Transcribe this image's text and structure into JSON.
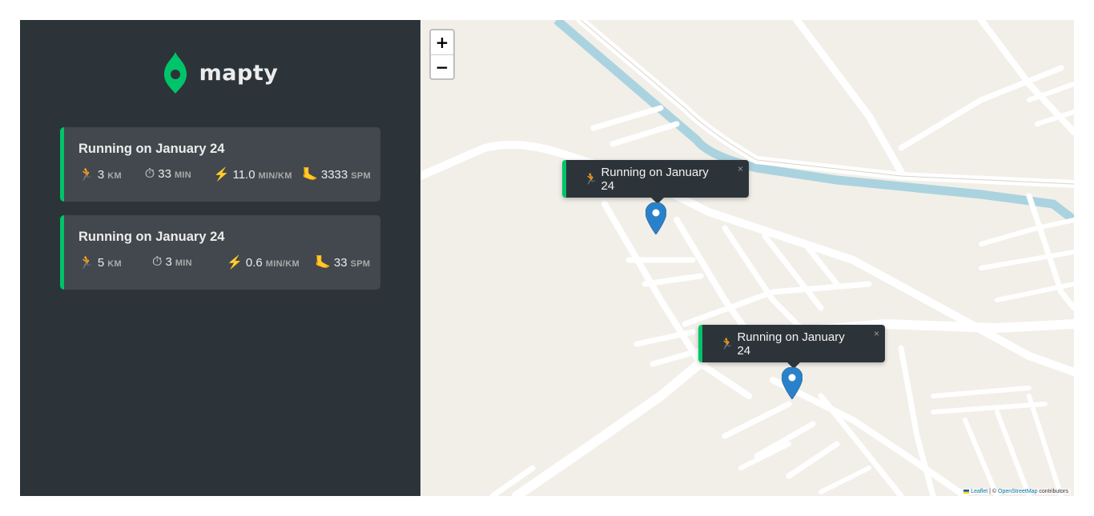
{
  "app": {
    "logo_text": "mapty"
  },
  "workouts": [
    {
      "title": "Running on January 24",
      "type": "running",
      "distance": {
        "icon": "🏃",
        "value": "3",
        "unit": "KM"
      },
      "duration": {
        "icon": "⏱",
        "value": "33",
        "unit": "MIN"
      },
      "pace": {
        "icon": "⚡",
        "value": "11.0",
        "unit": "MIN/KM"
      },
      "cadence": {
        "icon": "🦶",
        "value": "3333",
        "unit": "SPM"
      }
    },
    {
      "title": "Running on January 24",
      "type": "running",
      "distance": {
        "icon": "🏃",
        "value": "5",
        "unit": "KM"
      },
      "duration": {
        "icon": "⏱",
        "value": "3",
        "unit": "MIN"
      },
      "pace": {
        "icon": "⚡",
        "value": "0.6",
        "unit": "MIN/KM"
      },
      "cadence": {
        "icon": "🦶",
        "value": "33",
        "unit": "SPM"
      }
    }
  ],
  "map": {
    "zoom_in": "+",
    "zoom_out": "−",
    "popups": [
      {
        "icon": "🏃",
        "text": "Running on January 24",
        "close": "×"
      },
      {
        "icon": "🏃",
        "text": "Running on January 24",
        "close": "×"
      }
    ],
    "attribution": {
      "leaflet": "Leaflet",
      "separator": " | © ",
      "osm": "OpenStreetMap",
      "suffix": " contributors"
    }
  },
  "colors": {
    "sidebar_bg": "#2d3439",
    "card_bg": "#42484d",
    "accent_running": "#00c46a",
    "map_bg": "#f2efe9",
    "water": "#aad3df",
    "marker": "#2a81cb"
  }
}
